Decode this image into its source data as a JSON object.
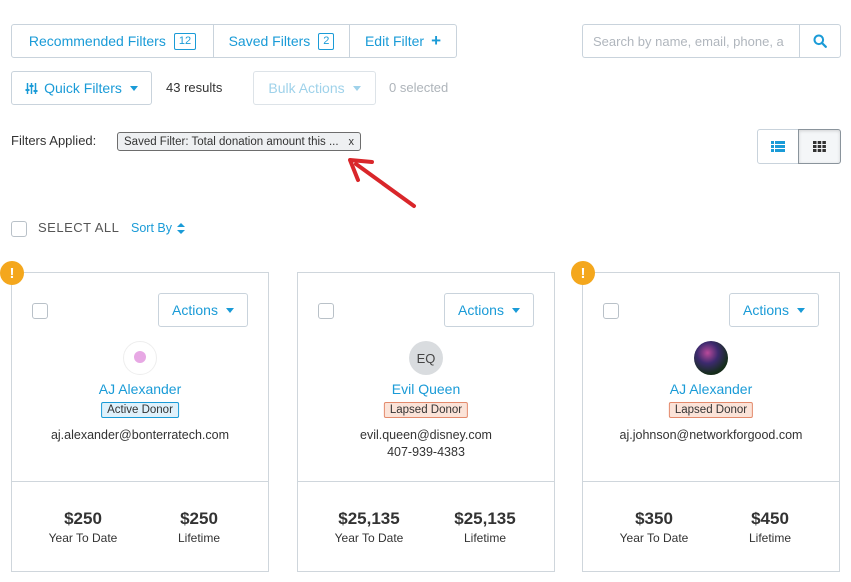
{
  "tabs": {
    "recommended_label": "Recommended Filters",
    "recommended_count": "12",
    "saved_label": "Saved Filters",
    "saved_count": "2",
    "edit_label": "Edit Filter"
  },
  "search": {
    "placeholder": "Search by name, email, phone, a"
  },
  "toolbar": {
    "quick_filters_label": "Quick Filters",
    "results_text": "43 results",
    "bulk_actions_label": "Bulk Actions",
    "selected_text": "0 selected"
  },
  "filters": {
    "applied_label": "Filters Applied:",
    "chip_text": "Saved Filter: Total donation amount this ...",
    "chip_close": "x"
  },
  "list_controls": {
    "select_all_label": "SELECT ALL",
    "sort_by_label": "Sort By"
  },
  "cards": [
    {
      "actions_label": "Actions",
      "name": "AJ Alexander",
      "status": "Active Donor",
      "email": "aj.alexander@bonterratech.com",
      "phone": "",
      "ytd_value": "$250",
      "ytd_label": "Year To Date",
      "lifetime_value": "$250",
      "lifetime_label": "Lifetime",
      "warning": "!"
    },
    {
      "actions_label": "Actions",
      "initials": "EQ",
      "name": "Evil Queen",
      "status": "Lapsed Donor",
      "email": "evil.queen@disney.com",
      "phone": "407-939-4383",
      "ytd_value": "$25,135",
      "ytd_label": "Year To Date",
      "lifetime_value": "$25,135",
      "lifetime_label": "Lifetime"
    },
    {
      "actions_label": "Actions",
      "name": "AJ Alexander",
      "status": "Lapsed Donor",
      "email": "aj.johnson@networkforgood.com",
      "phone": "",
      "ytd_value": "$350",
      "ytd_label": "Year To Date",
      "lifetime_value": "$450",
      "lifetime_label": "Lifetime",
      "warning": "!"
    }
  ],
  "icons": {
    "search": "search-icon",
    "quick_filters": "sliders-icon",
    "list_view": "list-view-icon",
    "grid_view": "grid-view-icon",
    "sort": "sort-icon",
    "warning": "warning-icon"
  },
  "colors": {
    "accent": "#1a9bd7",
    "warning": "#f4a71d",
    "active_badge_bg": "#dff1fb",
    "lapsed_badge_bg": "#fbe3d8",
    "annotation_arrow": "#d9262a"
  }
}
